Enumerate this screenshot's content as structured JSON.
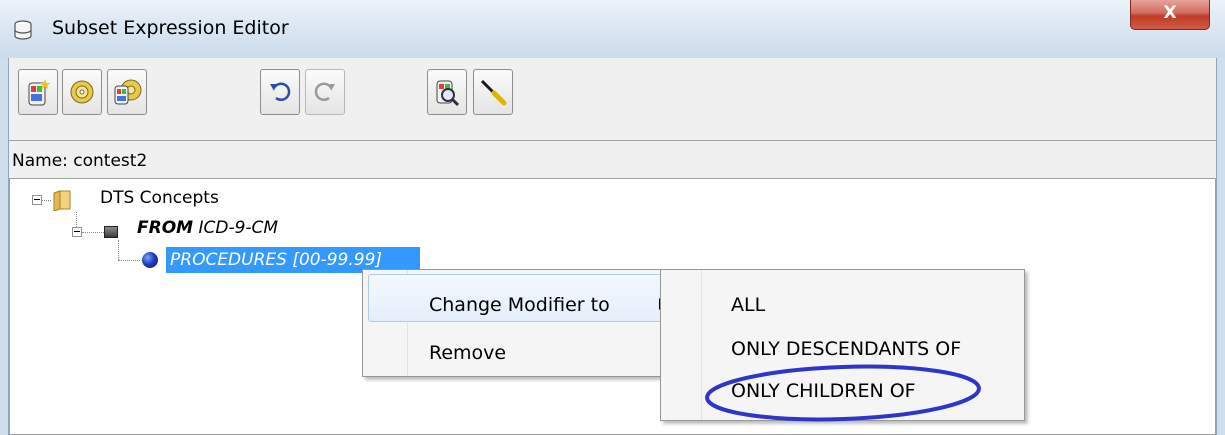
{
  "window": {
    "title": "Subset Expression Editor",
    "close_label": "X"
  },
  "toolbar": {
    "buttons": [
      {
        "icon": "new-expression-icon",
        "enabled": true
      },
      {
        "icon": "disc-icon",
        "enabled": true
      },
      {
        "icon": "disc-database-icon",
        "enabled": true
      },
      {
        "icon": "undo-icon",
        "enabled": true
      },
      {
        "icon": "redo-icon",
        "enabled": false
      },
      {
        "icon": "search-database-icon",
        "enabled": true
      },
      {
        "icon": "screwdriver-icon",
        "enabled": true
      }
    ]
  },
  "name_field": {
    "label": "Name: contest2"
  },
  "tree": {
    "root": {
      "label": "DTS Concepts",
      "icon": "folder-icon"
    },
    "from_node": {
      "keyword": "FROM",
      "value": "ICD-9-CM",
      "icon": "square-icon"
    },
    "leaf_node": {
      "label": "PROCEDURES [00-99.99]",
      "icon": "ball-icon",
      "selected": true
    }
  },
  "context_menu": {
    "items": [
      {
        "label": "Change Modifier to",
        "has_submenu": true
      },
      {
        "label": "Remove",
        "has_submenu": false
      }
    ]
  },
  "submenu": {
    "items": [
      {
        "label": "ALL"
      },
      {
        "label": "ONLY DESCENDANTS OF"
      },
      {
        "label": "ONLY CHILDREN OF",
        "circled": true
      }
    ]
  },
  "colors": {
    "selection": "#3399ff",
    "annotation_circle": "#2e35c8"
  }
}
